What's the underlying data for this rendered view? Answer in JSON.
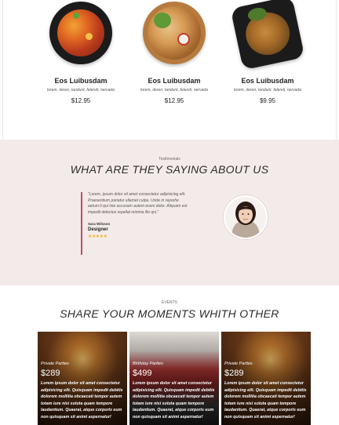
{
  "menu": {
    "items": [
      {
        "name": "Eos Luibusdam",
        "desc": "lorem, deren, tandunt, felendi, nervada",
        "price": "$12.95"
      },
      {
        "name": "Eos Luibusdam",
        "desc": "lorem, deren, tandunt, felendi, nervada",
        "price": "$12.95"
      },
      {
        "name": "Eos Luibusdam",
        "desc": "lorem, deren, tandunt, felendi, nervada",
        "price": "$9.95"
      }
    ]
  },
  "testimonial": {
    "eyebrow": "Testimonials",
    "title": "WHAT ARE THEY SAYING ABOUT US",
    "quote": "“Lorem, ipsum dolor sit amet consectetur adipisicing elit. Praesentium pariatur ullamet culpa. Unde in reprehe aetum ti qui Iste accusam autem eveni dolor. Aliquam est impedit delectus repellat minima illo qui.”",
    "name": "Sara Wilsson",
    "role": "Designer",
    "stars": "★★★★★",
    "rating": 5
  },
  "events": {
    "eyebrow": "EVENTS",
    "title": "SHARE YOUR MOMENTS WHITH OTHER",
    "cards": [
      {
        "label": "Private Parties",
        "price": "$289",
        "desc": "Lorem ipsum dolor sit amet consectetur adipisicing elit. Quisquam impedit debitis dolorem mollitia obcaecati tempor autem totam iure nisi soluta quam tempore laudantium. Quaerat, atque corporis eum non quisquam sit animi aspernatur!"
      },
      {
        "label": "Birthday Parties",
        "price": "$499",
        "desc": "Lorem ipsum dolor sit amet consectetur adipisicing elit. Quisquam impedit debitis dolorem mollitia obcaecati tempor autem totam iure nisi soluta quam tempore laudantium. Quaerat, atque corporis eum non quisquam sit animi aspernatur!"
      },
      {
        "label": "Private Parties",
        "price": "$289",
        "desc": "Lorem ipsum dolor sit amet consectetur adipisicing elit. Quisquam impedit debitis dolorem mollitia obcaecati tempor autem totam iure nisi soluta quam tempore laudantium. Quaerat, atque corporis eum non quisquam sit animi aspernatur!"
      }
    ]
  },
  "colors": {
    "accent": "#c94b55",
    "testimonial_bg": "#f3ebea",
    "star": "#f2b619"
  }
}
